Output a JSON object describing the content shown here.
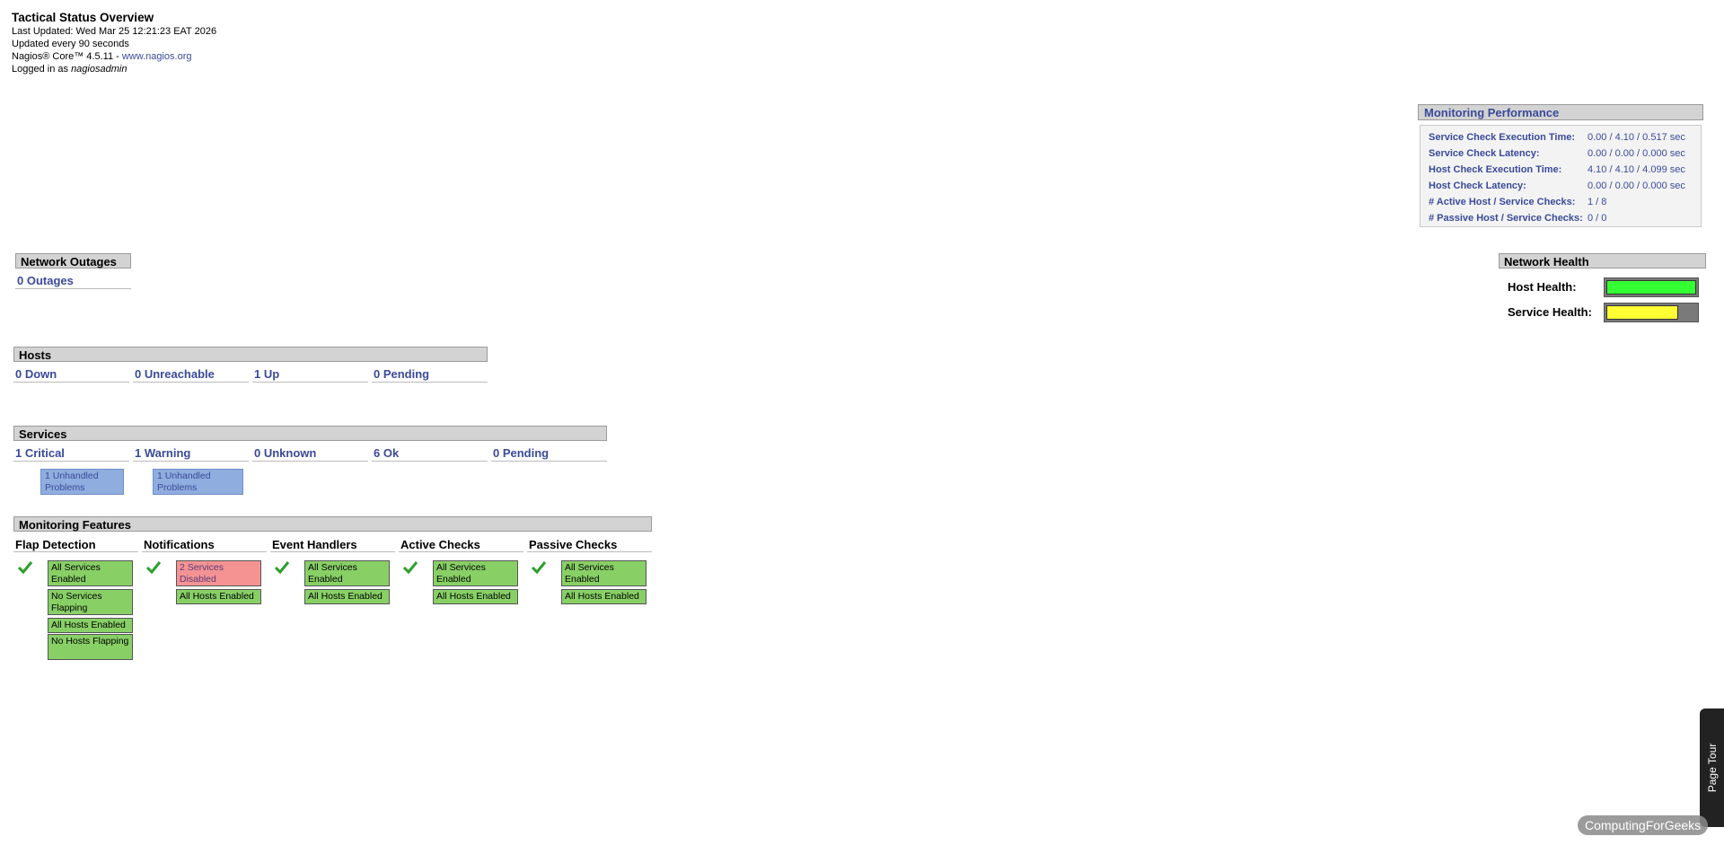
{
  "header": {
    "title": "Tactical Status Overview",
    "last_updated": "Last Updated: Wed Mar 25 12:21:23 EAT 2026",
    "update_interval": "Updated every 90 seconds",
    "version_prefix": "Nagios® Core™ 4.5.11 - ",
    "version_link": "www.nagios.org",
    "logged_prefix": "Logged in as ",
    "username": "nagiosadmin"
  },
  "monitoring_performance": {
    "title": "Monitoring Performance",
    "rows": [
      {
        "label": "Service Check Execution Time:",
        "value": "0.00 / 4.10 / 0.517 sec"
      },
      {
        "label": "Service Check Latency:",
        "value": "0.00 / 0.00 / 0.000 sec"
      },
      {
        "label": "Host Check Execution Time:",
        "value": "4.10 / 4.10 / 4.099 sec"
      },
      {
        "label": "Host Check Latency:",
        "value": "0.00 / 0.00 / 0.000 sec"
      },
      {
        "label": "# Active Host / Service Checks:",
        "value": "1 / 8"
      },
      {
        "label": "# Passive Host / Service Checks:",
        "value": "0 / 0"
      }
    ]
  },
  "network_outages": {
    "title": "Network Outages",
    "count": "0 Outages"
  },
  "network_health": {
    "title": "Network Health",
    "host_label": "Host Health:",
    "host_level": 1.0,
    "host_color": "#33ff33",
    "service_label": "Service Health:",
    "service_level": 0.8,
    "service_color": "#ffff33"
  },
  "hosts": {
    "title": "Hosts",
    "cells": [
      "0 Down",
      "0 Unreachable",
      "1 Up",
      "0 Pending"
    ]
  },
  "services": {
    "title": "Services",
    "cells": [
      "1 Critical",
      "1 Warning",
      "0 Unknown",
      "6 Ok",
      "0 Pending"
    ],
    "critical_unhandled": "1 Unhandled Problems",
    "warning_unhandled": "1 Unhandled Problems"
  },
  "monitoring_features": {
    "title": "Monitoring Features",
    "columns": [
      {
        "name": "Flap Detection",
        "items": [
          "All Services Enabled",
          "No Services Flapping",
          "All Hosts Enabled",
          "No Hosts Flapping"
        ]
      },
      {
        "name": "Notifications",
        "items": [
          "2 Services Disabled",
          "All Hosts Enabled"
        ]
      },
      {
        "name": "Event Handlers",
        "items": [
          "All Services Enabled",
          "All Hosts Enabled"
        ]
      },
      {
        "name": "Active Checks",
        "items": [
          "All Services Enabled",
          "All Hosts Enabled"
        ]
      },
      {
        "name": "Passive Checks",
        "items": [
          "All Services Enabled",
          "All Hosts Enabled"
        ]
      }
    ],
    "ok_color": "#88d066",
    "problem_color": "#f59393"
  },
  "page_tour": {
    "label": "Page Tour"
  },
  "watermark": {
    "label": "ComputingForGeeks"
  }
}
